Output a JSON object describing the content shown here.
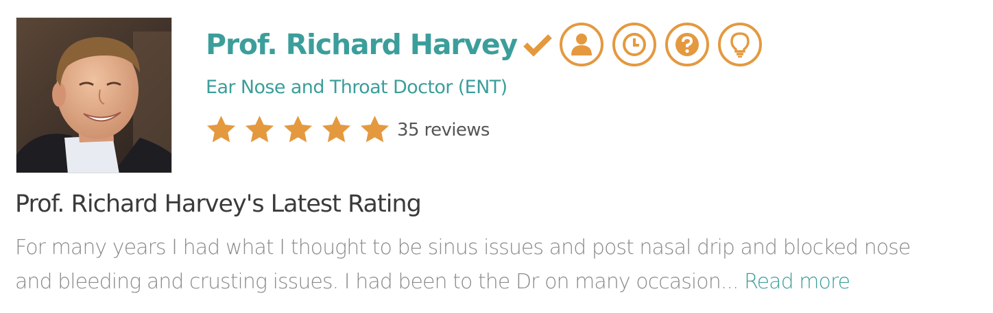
{
  "doctor": {
    "name": "Prof. Richard Harvey",
    "specialty": "Ear Nose and Throat Doctor (ENT)",
    "photo_alt": "Prof. Richard Harvey",
    "verified_icon": "checkmark-icon",
    "badges": [
      {
        "icon": "user-icon"
      },
      {
        "icon": "clock-icon"
      },
      {
        "icon": "question-icon"
      },
      {
        "icon": "lightbulb-icon"
      }
    ]
  },
  "rating": {
    "stars": 5,
    "max_stars": 5,
    "reviews_label": "35 reviews"
  },
  "latest": {
    "title": "Prof. Richard Harvey's Latest Rating",
    "line1": "For many years I had what I thought to be sinus issues and post nasal drip and blocked nose",
    "line2": "and bleeding and crusting issues. I had been to the Dr on many occasion...",
    "read_more": "Read more"
  },
  "colors": {
    "teal": "#3b9e9b",
    "orange": "#e4993f",
    "text_dark": "#3a3a3a",
    "text_grey": "#8a8a8a"
  }
}
